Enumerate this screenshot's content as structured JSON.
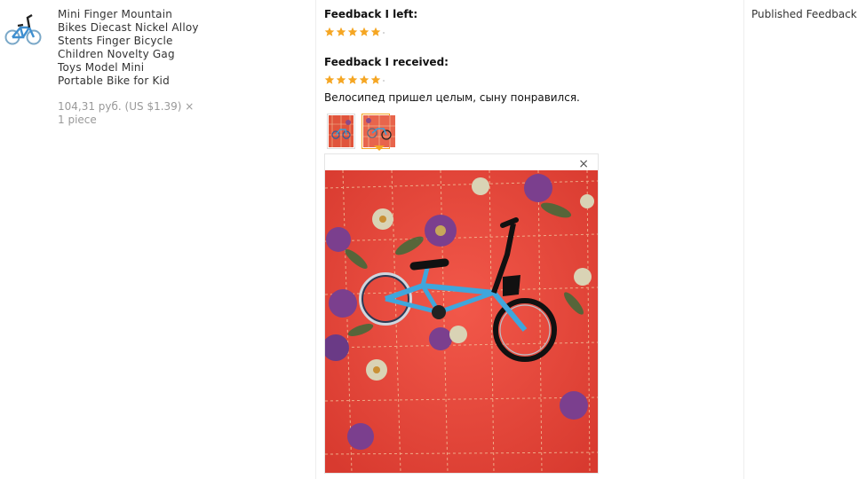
{
  "product": {
    "title_lines": [
      "Mini Finger Mountain",
      "Bikes Diecast Nickel Alloy",
      "Stents Finger Bicycle",
      "Children Novelty Gag",
      "Toys Model Mini",
      "Portable Bike for Kid"
    ],
    "price_line1": "104,31 руб. (US $1.39) ×",
    "price_line2": "1 piece",
    "thumbnail_icon": "bicycle-thumbnail"
  },
  "feedback": {
    "left_label": "Feedback I left:",
    "left_rating": 5,
    "received_label": "Feedback I received:",
    "received_rating": 5,
    "comment": "Велосипед пришел целым, сыну понравился.",
    "photos_count": 2,
    "active_photo": 2,
    "close_symbol": "×",
    "star_color": "#f5a623"
  },
  "status": {
    "published": "Published Feedback"
  }
}
